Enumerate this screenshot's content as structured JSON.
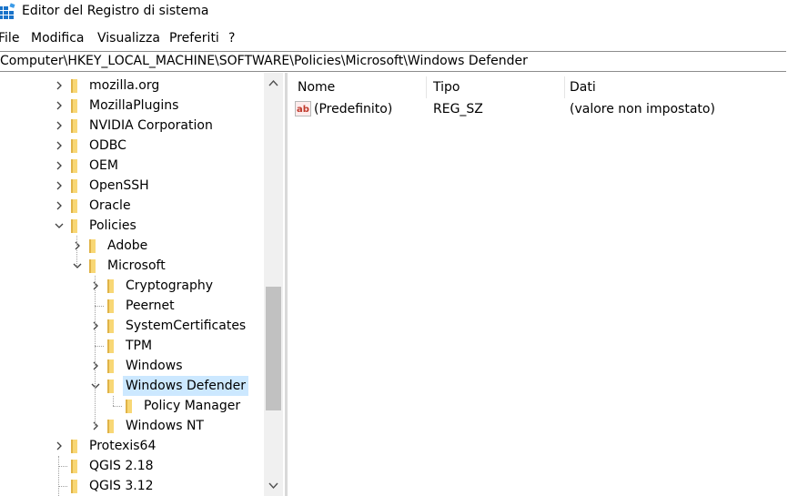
{
  "window": {
    "title": "Editor del Registro di sistema"
  },
  "menu": [
    "File",
    "Modifica",
    "Visualizza",
    "Preferiti",
    "?"
  ],
  "address": "Computer\\HKEY_LOCAL_MACHINE\\SOFTWARE\\Policies\\Microsoft\\Windows Defender",
  "tree": [
    {
      "label": "mozilla.org",
      "depth": 0,
      "expander": "collapsed"
    },
    {
      "label": "MozillaPlugins",
      "depth": 0,
      "expander": "collapsed"
    },
    {
      "label": "NVIDIA Corporation",
      "depth": 0,
      "expander": "collapsed"
    },
    {
      "label": "ODBC",
      "depth": 0,
      "expander": "collapsed"
    },
    {
      "label": "OEM",
      "depth": 0,
      "expander": "collapsed"
    },
    {
      "label": "OpenSSH",
      "depth": 0,
      "expander": "collapsed"
    },
    {
      "label": "Oracle",
      "depth": 0,
      "expander": "collapsed"
    },
    {
      "label": "Policies",
      "depth": 0,
      "expander": "expanded"
    },
    {
      "label": "Adobe",
      "depth": 1,
      "expander": "collapsed"
    },
    {
      "label": "Microsoft",
      "depth": 1,
      "expander": "expanded"
    },
    {
      "label": "Cryptography",
      "depth": 2,
      "expander": "collapsed"
    },
    {
      "label": "Peernet",
      "depth": 2,
      "expander": "none"
    },
    {
      "label": "SystemCertificates",
      "depth": 2,
      "expander": "collapsed"
    },
    {
      "label": "TPM",
      "depth": 2,
      "expander": "none"
    },
    {
      "label": "Windows",
      "depth": 2,
      "expander": "collapsed"
    },
    {
      "label": "Windows Defender",
      "depth": 2,
      "expander": "expanded",
      "selected": true
    },
    {
      "label": "Policy Manager",
      "depth": 3,
      "expander": "none"
    },
    {
      "label": "Windows NT",
      "depth": 2,
      "expander": "collapsed"
    },
    {
      "label": "Protexis64",
      "depth": 0,
      "expander": "collapsed"
    },
    {
      "label": "QGIS 2.18",
      "depth": 0,
      "expander": "none"
    },
    {
      "label": "QGIS 3.12",
      "depth": 0,
      "expander": "none"
    }
  ],
  "list": {
    "columns": [
      "Nome",
      "Tipo",
      "Dati"
    ],
    "rows": [
      {
        "name": "(Predefinito)",
        "type": "REG_SZ",
        "data": "(valore non impostato)",
        "icon": "string-value-icon"
      }
    ]
  },
  "colors": {
    "selection": "#cce8ff",
    "folder": "#f8d775",
    "folder_dark": "#e0b348",
    "icon_red": "#c0392b"
  }
}
